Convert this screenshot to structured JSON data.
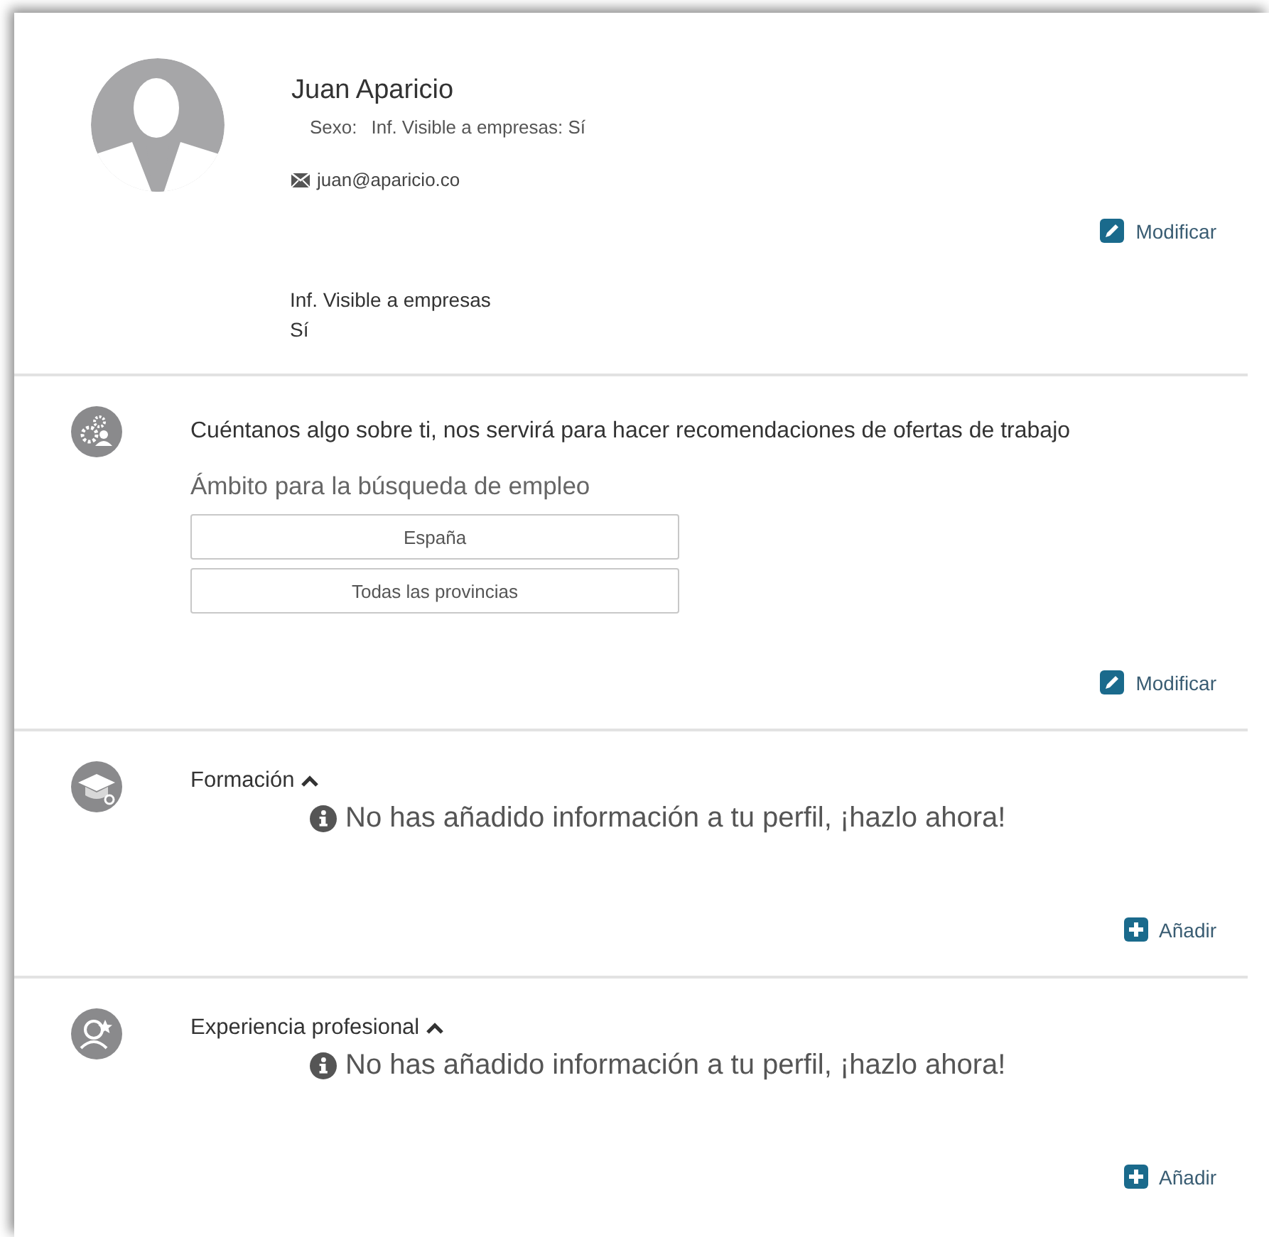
{
  "profile": {
    "name": "Juan Aparicio",
    "meta": [
      "Sexo:",
      "Inf. Visible a empresas: Sí"
    ],
    "email": "juan@aparicio.co",
    "action": "Modificar",
    "visibility": {
      "label": "Inf. Visible a empresas",
      "value": "Sí"
    }
  },
  "preferences": {
    "title": "Cuéntanos algo sobre ti, nos servirá para hacer recomendaciones de ofertas de trabajo",
    "subtitle": "Ámbito para la búsqueda de empleo",
    "options": [
      "España",
      "Todas las provincias"
    ],
    "action": "Modificar"
  },
  "sections": [
    {
      "kind": "education",
      "title": "Formación",
      "expanded": true,
      "message": "No has añadido información a tu perfil, ¡hazlo ahora!",
      "action": "Añadir"
    },
    {
      "kind": "experience",
      "title": "Experiencia profesional",
      "expanded": true,
      "message": "No has añadido información a tu perfil, ¡hazlo ahora!",
      "action": "Añadir"
    }
  ]
}
